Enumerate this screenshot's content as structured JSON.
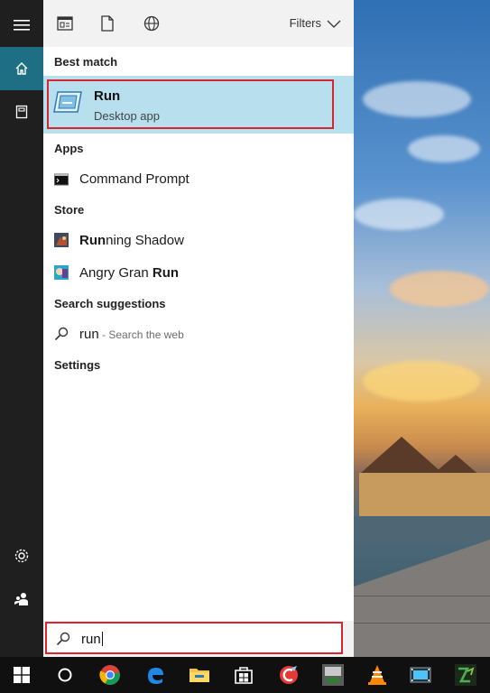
{
  "panel": {
    "toolbar": {
      "filters_label": "Filters"
    },
    "sections": {
      "best_match": "Best match",
      "apps": "Apps",
      "store": "Store",
      "search_suggestions": "Search suggestions",
      "settings": "Settings"
    },
    "best_match": {
      "title": "Run",
      "subtitle": "Desktop app"
    },
    "apps": [
      {
        "label": "Command Prompt"
      }
    ],
    "store": [
      {
        "label_bold": "Run",
        "label_rest": "ning Shadow"
      },
      {
        "label_rest": "Angry Gran ",
        "label_bold": "Run"
      }
    ],
    "search_suggestion": {
      "query": "run",
      "hint": " - Search the web"
    }
  },
  "search": {
    "value": "run"
  },
  "colors": {
    "accent": "#1e6f83",
    "highlight": "#b7dfee",
    "outline_red": "#d9252f"
  },
  "icons": {
    "hamburger": "menu-icon",
    "home": "home-icon",
    "notebook": "notebook-icon",
    "settings": "gear-icon",
    "people": "people-icon",
    "documents": "document-icon",
    "web": "globe-icon",
    "filter_chevron": "chevron-down-icon",
    "search": "search-icon"
  }
}
